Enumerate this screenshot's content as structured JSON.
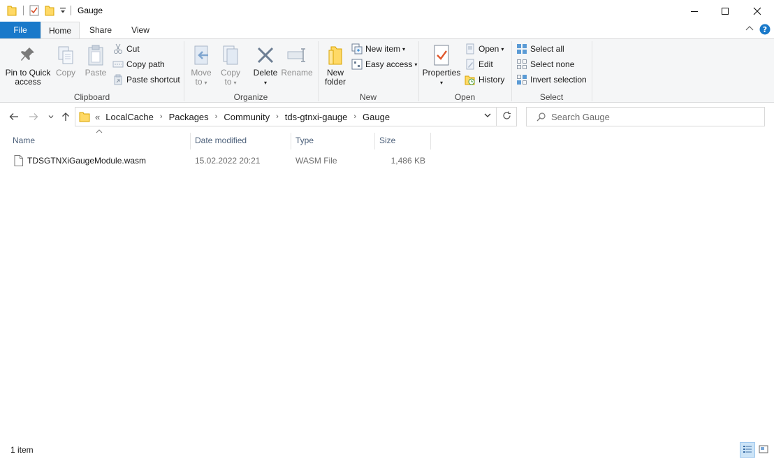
{
  "window": {
    "title": "Gauge",
    "controls": [
      "minimize",
      "maximize",
      "close"
    ]
  },
  "ribbon_tabs": {
    "file": "File",
    "home": "Home",
    "share": "Share",
    "view": "View"
  },
  "clipboard": {
    "group_label": "Clipboard",
    "pin_line1": "Pin to Quick",
    "pin_line2": "access",
    "copy": "Copy",
    "paste": "Paste",
    "cut": "Cut",
    "copy_path": "Copy path",
    "paste_shortcut": "Paste shortcut"
  },
  "organize": {
    "group_label": "Organize",
    "move_line1": "Move",
    "move_line2": "to",
    "copy_line1": "Copy",
    "copy_line2": "to",
    "delete": "Delete",
    "rename": "Rename"
  },
  "new": {
    "group_label": "New",
    "new_folder_line1": "New",
    "new_folder_line2": "folder",
    "new_item": "New item",
    "easy_access": "Easy access"
  },
  "open": {
    "group_label": "Open",
    "properties": "Properties",
    "open": "Open",
    "edit": "Edit",
    "history": "History"
  },
  "select": {
    "group_label": "Select",
    "select_all": "Select all",
    "select_none": "Select none",
    "invert_selection": "Invert selection"
  },
  "address": {
    "overflow": "«",
    "crumbs": [
      "LocalCache",
      "Packages",
      "Community",
      "tds-gtnxi-gauge",
      "Gauge"
    ]
  },
  "search": {
    "placeholder": "Search Gauge"
  },
  "columns": {
    "name": "Name",
    "date_modified": "Date modified",
    "type": "Type",
    "size": "Size"
  },
  "files": [
    {
      "name": "TDSGTNXiGaugeModule.wasm",
      "date_modified": "15.02.2022 20:21",
      "type": "WASM File",
      "size": "1,486 KB"
    }
  ],
  "status": {
    "item_count": "1 item"
  },
  "colors": {
    "accent": "#1979ca",
    "ribbon_bg": "#f5f6f7",
    "header_text": "#4c607a",
    "folder_yellow": "#ffd966"
  }
}
